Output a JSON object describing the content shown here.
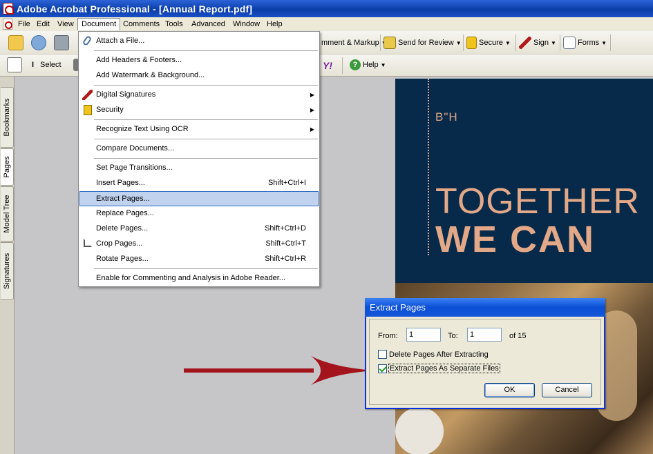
{
  "window": {
    "title": "Adobe Acrobat Professional - [Annual Report.pdf]"
  },
  "menubar": {
    "items": [
      "File",
      "Edit",
      "View",
      "Document",
      "Comments",
      "Tools",
      "Advanced",
      "Window",
      "Help"
    ],
    "active": "Document"
  },
  "toolbar1": {
    "comment_markup": "mment & Markup",
    "send_for_review": "Send for Review",
    "secure": "Secure",
    "sign": "Sign",
    "forms": "Forms"
  },
  "toolbar2": {
    "select": "Select",
    "help": "Help"
  },
  "sidebar": {
    "tabs": [
      "Bookmarks",
      "Pages",
      "Model Tree",
      "Signatures"
    ],
    "selected": "Pages"
  },
  "document_menu": {
    "items": [
      {
        "label": "Attach a File...",
        "shortcut": "",
        "submenu": false,
        "icon": "paperclip-icon"
      },
      {
        "label": "Add Headers & Footers...",
        "shortcut": "",
        "submenu": false,
        "icon": ""
      },
      {
        "label": "Add Watermark & Background...",
        "shortcut": "",
        "submenu": false,
        "icon": ""
      },
      {
        "label": "Digital Signatures",
        "shortcut": "",
        "submenu": true,
        "icon": "pen-icon"
      },
      {
        "label": "Security",
        "shortcut": "",
        "submenu": true,
        "icon": "lock-icon"
      },
      {
        "label": "Recognize Text Using OCR",
        "shortcut": "",
        "submenu": true,
        "icon": ""
      },
      {
        "label": "Compare Documents...",
        "shortcut": "",
        "submenu": false,
        "icon": ""
      },
      {
        "label": "Set Page Transitions...",
        "shortcut": "",
        "submenu": false,
        "icon": ""
      },
      {
        "label": "Insert Pages...",
        "shortcut": "Shift+Ctrl+I",
        "submenu": false,
        "icon": ""
      },
      {
        "label": "Extract Pages...",
        "shortcut": "",
        "submenu": false,
        "icon": "",
        "highlighted": true
      },
      {
        "label": "Replace Pages...",
        "shortcut": "",
        "submenu": false,
        "icon": ""
      },
      {
        "label": "Delete Pages...",
        "shortcut": "Shift+Ctrl+D",
        "submenu": false,
        "icon": ""
      },
      {
        "label": "Crop Pages...",
        "shortcut": "Shift+Ctrl+T",
        "submenu": false,
        "icon": "crop-icon"
      },
      {
        "label": "Rotate Pages...",
        "shortcut": "Shift+Ctrl+R",
        "submenu": false,
        "icon": ""
      },
      {
        "label": "Enable for Commenting and Analysis in Adobe Reader...",
        "shortcut": "",
        "submenu": false,
        "icon": ""
      }
    ]
  },
  "page_preview": {
    "bh": "B\"H",
    "line1": "TOGETHER",
    "line2": "WE CAN"
  },
  "extract_dialog": {
    "title": "Extract Pages",
    "from_label": "From:",
    "from_value": "1",
    "to_label": "To:",
    "to_value": "1",
    "of_text": "of 15",
    "delete_after_label": "Delete Pages After Extracting",
    "delete_after_checked": false,
    "separate_files_label": "Extract Pages As Separate Files",
    "separate_files_checked": true,
    "ok_label": "OK",
    "cancel_label": "Cancel"
  },
  "colors": {
    "title_bar": "#0a3ea8",
    "menu_highlight": "#c1d2ee",
    "page_navy": "#072a4a",
    "page_accent": "#e2a887",
    "arrow_red": "#a3141c"
  }
}
